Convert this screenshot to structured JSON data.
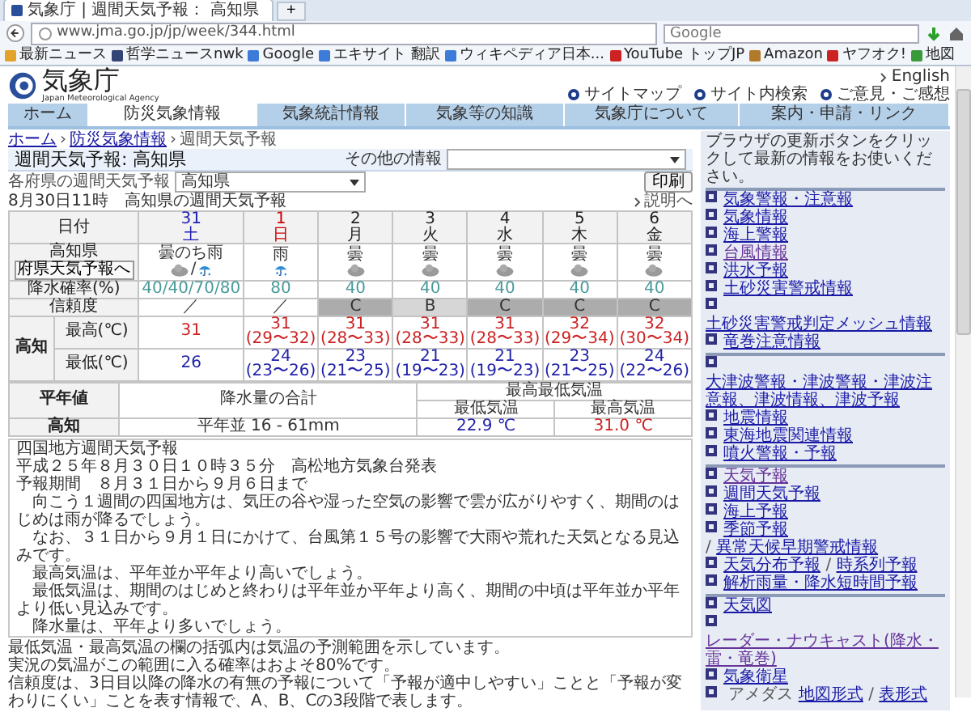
{
  "browser": {
    "tab_title": "気象庁 | 週間天気予報： 高知県",
    "new_tab": "+",
    "url": "www.jma.go.jp/jp/week/344.html",
    "search_placeholder": "Google",
    "bookmarks": [
      "最新ニュース",
      "哲学ニュースnwk",
      "Google",
      "エキサイト 翻訳",
      "ウィキペディア日本...",
      "YouTube トップJP",
      "Amazon",
      "ヤフオク!",
      "地図"
    ]
  },
  "header": {
    "logo": "気象庁",
    "logo_sub": "Japan Meteorological Agency",
    "english": "English",
    "links": [
      "サイトマップ",
      "サイト内検索",
      "ご意見・ご感想"
    ]
  },
  "nav": [
    {
      "label": "ホーム",
      "selected": false
    },
    {
      "label": "防災気象情報",
      "selected": true
    },
    {
      "label": "気象統計情報",
      "selected": false
    },
    {
      "label": "気象等の知識",
      "selected": false
    },
    {
      "label": "気象庁について",
      "selected": false
    },
    {
      "label": "案内・申請・リンク",
      "selected": false
    }
  ],
  "breadcrumb": [
    "ホーム",
    "防災気象情報",
    "週間天気予報"
  ],
  "breadcrumb_separator": "›",
  "title": "週間天気予報: 高知県",
  "other_info_label": "その他の情報",
  "pref_select_label": "各府県の週間天気予報",
  "pref_select_value": "高知県",
  "print_button": "印刷",
  "help_link": "説明へ",
  "caption": "8月30日11時　高知県の週間天気予報",
  "forecast": {
    "date_header": "日付",
    "region": "高知県",
    "region_button": "府県天気予報へ",
    "pop_label": "降水確率(%)",
    "reliability_label": "信頼度",
    "city": "高知",
    "max_label": "最高(℃)",
    "min_label": "最低(℃)",
    "days": [
      {
        "date": "31",
        "weekday": "土",
        "color": "#1c1cb4",
        "weather": "曇のち雨",
        "icons": [
          {
            "kind": "cloud"
          },
          {
            "kind": "rain"
          }
        ],
        "joiner": "/",
        "pop": "40/40/70/80",
        "reliability": {
          "text": "／",
          "color": "#ffffff"
        },
        "max": {
          "value": "31"
        },
        "min": {
          "value": "26"
        }
      },
      {
        "date": "1",
        "weekday": "日",
        "color": "#cc0000",
        "weather": "雨",
        "icons": [
          {
            "kind": "rain"
          }
        ],
        "pop": "80",
        "reliability": {
          "text": "／",
          "color": "#ffffff"
        },
        "max": {
          "value": "31",
          "range": "(29〜32)"
        },
        "min": {
          "value": "24",
          "range": "(23〜26)"
        }
      },
      {
        "date": "2",
        "weekday": "月",
        "color": "#222222",
        "weather": "曇",
        "icons": [
          {
            "kind": "cloud"
          }
        ],
        "pop": "40",
        "reliability": {
          "text": "C",
          "color": "#acacac"
        },
        "max": {
          "value": "31",
          "range": "(28〜33)"
        },
        "min": {
          "value": "23",
          "range": "(21〜25)"
        }
      },
      {
        "date": "3",
        "weekday": "火",
        "color": "#222222",
        "weather": "曇",
        "icons": [
          {
            "kind": "cloud"
          }
        ],
        "pop": "40",
        "reliability": {
          "text": "B",
          "color": "#d6d6d6"
        },
        "max": {
          "value": "31",
          "range": "(28〜33)"
        },
        "min": {
          "value": "21",
          "range": "(19〜23)"
        }
      },
      {
        "date": "4",
        "weekday": "水",
        "color": "#222222",
        "weather": "曇",
        "icons": [
          {
            "kind": "cloud"
          }
        ],
        "pop": "40",
        "reliability": {
          "text": "C",
          "color": "#acacac"
        },
        "max": {
          "value": "31",
          "range": "(28〜33)"
        },
        "min": {
          "value": "21",
          "range": "(19〜23)"
        }
      },
      {
        "date": "5",
        "weekday": "木",
        "color": "#222222",
        "weather": "曇",
        "icons": [
          {
            "kind": "cloud"
          }
        ],
        "pop": "40",
        "reliability": {
          "text": "C",
          "color": "#acacac"
        },
        "max": {
          "value": "32",
          "range": "(29〜34)"
        },
        "min": {
          "value": "23",
          "range": "(21〜25)"
        }
      },
      {
        "date": "6",
        "weekday": "金",
        "color": "#222222",
        "weather": "曇",
        "icons": [
          {
            "kind": "cloud"
          }
        ],
        "pop": "40",
        "reliability": {
          "text": "C",
          "color": "#acacac"
        },
        "max": {
          "value": "32",
          "range": "(30〜34)"
        },
        "min": {
          "value": "24",
          "range": "(22〜26)"
        }
      }
    ]
  },
  "normals": {
    "label": "平年値",
    "precip_header": "降水量の合計",
    "temp_header": "最高最低気温",
    "min_header": "最低気温",
    "max_header": "最高気温",
    "city": "高知",
    "precip": "平年並 16 - 61mm",
    "min": "22.9 ℃",
    "max": "31.0 ℃"
  },
  "report": {
    "title": "四国地方週間天気予報",
    "issued": "平成２５年８月３０日１０時３５分　高松地方気象台発表",
    "period": "予報期間　８月３１日から９月６日まで",
    "paragraphs": [
      "　向こう１週間の四国地方は、気圧の谷や湿った空気の影響で雲が広がりやすく、期間のはじめは雨が降るでしょう。",
      "　なお、３１日から９月１日にかけて、台風第１５号の影響で大雨や荒れた天気となる見込みです。",
      "　最高気温は、平年並か平年より高いでしょう。",
      "　最低気温は、期間のはじめと終わりは平年並か平年より高く、期間の中頃は平年並か平年より低い見込みです。",
      "　降水量は、平年より多いでしょう。"
    ]
  },
  "notes": [
    "最低気温・最高気温の欄の括弧内は気温の予測範囲を示しています。",
    "実況の気温がこの範囲に入る確率はおよそ80%です。",
    "信頼度は、3日目以降の降水の有無の予報について「予報が適中しやすい」ことと「予報が変わりにくい」ことを表す情報で、A、B、Cの3段階で表します。"
  ],
  "sidebar": {
    "intro": "ブラウザの更新ボタンをクリックして最新の情報をお使いください。",
    "groups": [
      [
        {
          "parts": [
            {
              "kind": "link",
              "text": "気象警報・注意報",
              "visited": false
            }
          ]
        },
        {
          "parts": [
            {
              "kind": "link",
              "text": "気象情報",
              "visited": false
            }
          ]
        },
        {
          "parts": [
            {
              "kind": "link",
              "text": "海上警報",
              "visited": false
            }
          ]
        },
        {
          "parts": [
            {
              "kind": "link",
              "text": "台風情報",
              "visited": true
            }
          ]
        },
        {
          "parts": [
            {
              "kind": "link",
              "text": "洪水予報",
              "visited": false
            }
          ]
        },
        {
          "parts": [
            {
              "kind": "link",
              "text": "土砂災害警戒情報",
              "visited": false
            }
          ]
        },
        {
          "parts": [
            {
              "kind": "link",
              "text": "土砂災害警戒判定メッシュ情報",
              "visited": false
            }
          ]
        },
        {
          "parts": [
            {
              "kind": "link",
              "text": "竜巻注意情報",
              "visited": false
            }
          ]
        }
      ],
      [
        {
          "parts": [
            {
              "kind": "link",
              "text": "大津波警報・津波警報・津波注意報、津波情報、津波予報",
              "visited": false
            }
          ]
        },
        {
          "parts": [
            {
              "kind": "link",
              "text": "地震情報",
              "visited": false
            }
          ]
        },
        {
          "parts": [
            {
              "kind": "link",
              "text": "東海地震関連情報",
              "visited": false
            }
          ]
        },
        {
          "parts": [
            {
              "kind": "link",
              "text": "噴火警報・予報",
              "visited": false
            }
          ]
        }
      ],
      [
        {
          "parts": [
            {
              "kind": "link",
              "text": "天気予報",
              "visited": true
            }
          ]
        },
        {
          "parts": [
            {
              "kind": "link",
              "text": "週間天気予報",
              "visited": false
            }
          ]
        },
        {
          "parts": [
            {
              "kind": "link",
              "text": "海上予報",
              "visited": false
            }
          ]
        },
        {
          "parts": [
            {
              "kind": "link",
              "text": "季節予報",
              "visited": false
            },
            {
              "kind": "plain",
              "text": "/"
            },
            {
              "kind": "link",
              "text": "異常天候早期警戒情報",
              "visited": false
            }
          ]
        },
        {
          "parts": [
            {
              "kind": "link",
              "text": "天気分布予報",
              "visited": false
            },
            {
              "kind": "plain",
              "text": "/"
            },
            {
              "kind": "link",
              "text": "時系列予報",
              "visited": false
            }
          ]
        },
        {
          "parts": [
            {
              "kind": "link",
              "text": "解析雨量・降水短時間予報",
              "visited": false
            }
          ]
        }
      ],
      [
        {
          "parts": [
            {
              "kind": "link",
              "text": "天気図",
              "visited": false
            }
          ]
        },
        {
          "parts": [
            {
              "kind": "link",
              "text": "レーダー・ナウキャスト(降水・雷・竜巻)",
              "visited": true
            }
          ]
        },
        {
          "parts": [
            {
              "kind": "link",
              "text": "気象衛星",
              "visited": false
            }
          ]
        },
        {
          "parts": [
            {
              "kind": "plain",
              "text": "アメダス"
            },
            {
              "kind": "link",
              "text": "地図形式",
              "visited": false
            },
            {
              "kind": "plain",
              "text": "/"
            },
            {
              "kind": "link",
              "text": "表形式",
              "visited": false
            }
          ]
        }
      ]
    ]
  }
}
